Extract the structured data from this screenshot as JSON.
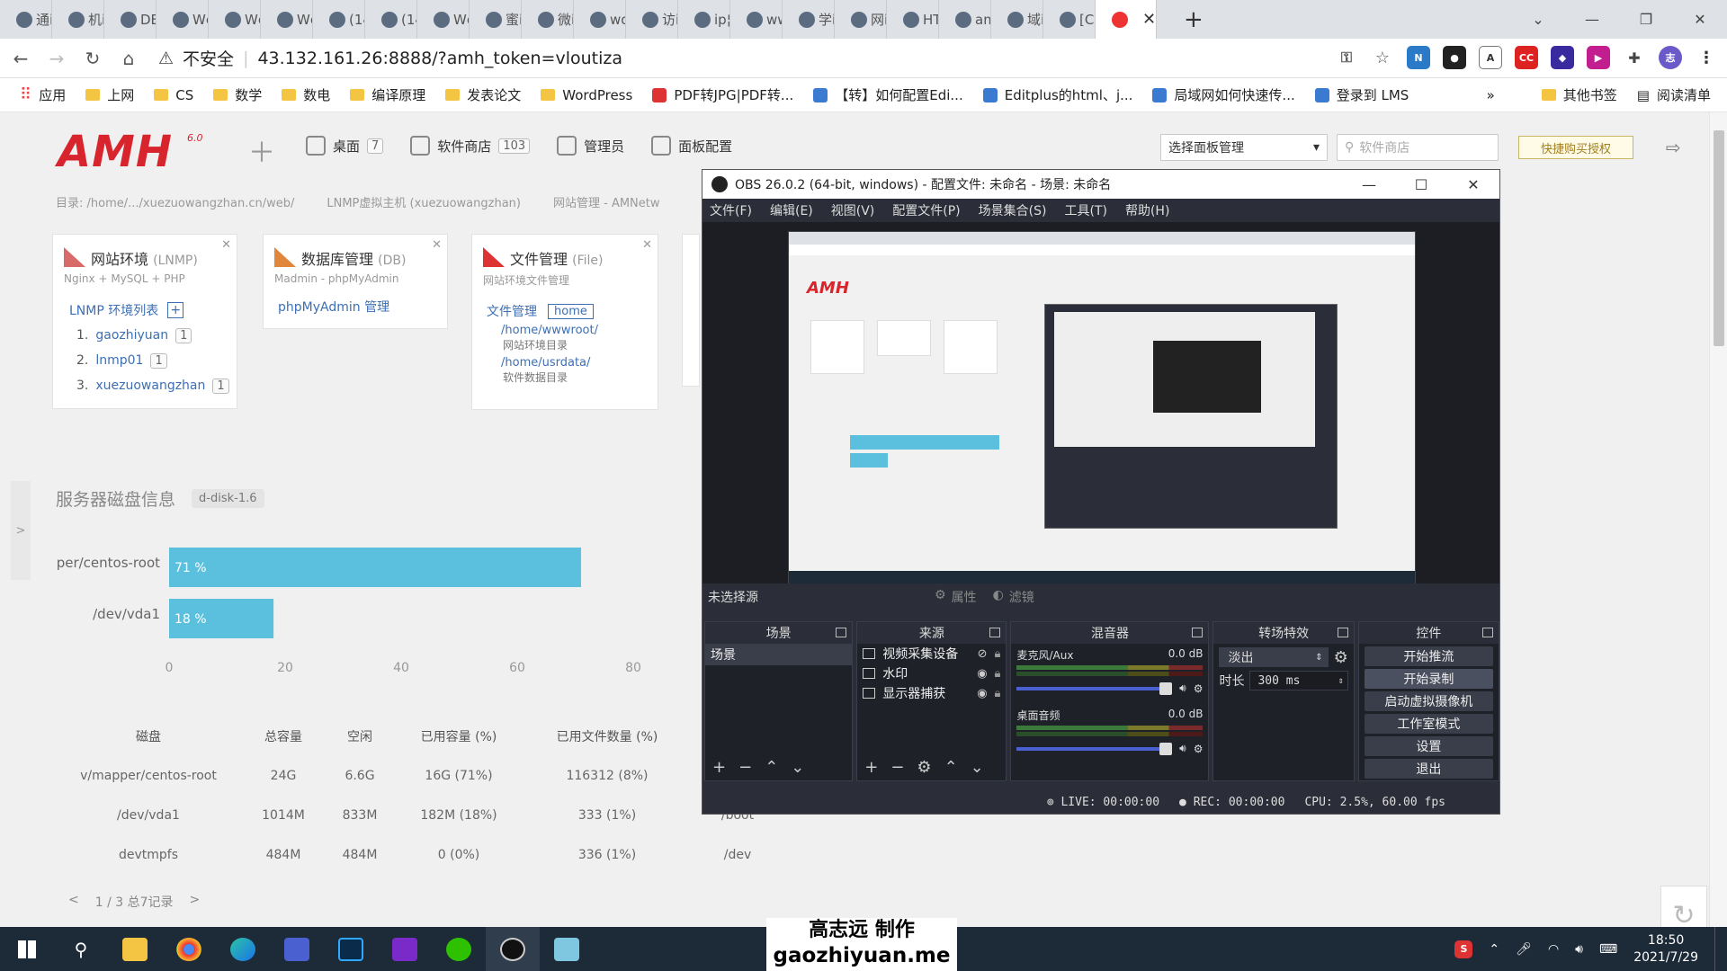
{
  "browser": {
    "tabs": [
      {
        "label": "通i"
      },
      {
        "label": "机i"
      },
      {
        "label": "DE"
      },
      {
        "label": "Wc"
      },
      {
        "label": "Wc"
      },
      {
        "label": "Wc"
      },
      {
        "label": "(14"
      },
      {
        "label": "(14"
      },
      {
        "label": "Wc"
      },
      {
        "label": "蜜i"
      },
      {
        "label": "微i"
      },
      {
        "label": "wo"
      },
      {
        "label": "访i"
      },
      {
        "label": "ip¦"
      },
      {
        "label": "ww"
      },
      {
        "label": "学i"
      },
      {
        "label": "网i"
      },
      {
        "label": "HT"
      },
      {
        "label": "am"
      },
      {
        "label": "域i"
      },
      {
        "label": "[CI"
      },
      {
        "label": ""
      }
    ],
    "insecure_label": "不安全",
    "url": "43.132.161.26:8888/?amh_token=vloutiza",
    "bookmarks": [
      {
        "label": "应用",
        "icon": "apps-icon"
      },
      {
        "label": "上网",
        "icon": "folder-icon"
      },
      {
        "label": "CS",
        "icon": "folder-icon"
      },
      {
        "label": "数学",
        "icon": "folder-icon"
      },
      {
        "label": "数电",
        "icon": "folder-icon"
      },
      {
        "label": "编译原理",
        "icon": "folder-icon"
      },
      {
        "label": "发表论文",
        "icon": "folder-icon"
      },
      {
        "label": "WordPress",
        "icon": "folder-icon"
      },
      {
        "label": "PDF转JPG|PDF转...",
        "icon": "pdf-icon"
      },
      {
        "label": "【转】如何配置Edi...",
        "icon": "link-icon"
      },
      {
        "label": "Editplus的html、j...",
        "icon": "link-icon"
      },
      {
        "label": "局域网如何快速传...",
        "icon": "link-icon"
      },
      {
        "label": "登录到 LMS",
        "icon": "link-icon"
      }
    ],
    "bookmarks_more": "»",
    "other_bookmarks": "其他书签",
    "reading_list": "阅读清单"
  },
  "amh": {
    "logo": "AMH",
    "version": "6.0",
    "nav": [
      {
        "label": "桌面",
        "badge": "7",
        "icon": "home-icon"
      },
      {
        "label": "软件商店",
        "badge": "103",
        "icon": "store-icon"
      },
      {
        "label": "管理员",
        "badge": "",
        "icon": "user-icon"
      },
      {
        "label": "面板配置",
        "badge": "",
        "icon": "gear-icon"
      }
    ],
    "panel_select": "选择面板管理",
    "search_placeholder": "软件商店",
    "buy_button": "快捷购买授权",
    "breadcrumbs": [
      "目录: /home/.../xuezuowangzhan.cn/web/",
      "LNMP虚拟主机 (xuezuowangzhan)",
      "网站管理 - AMNetw"
    ],
    "cards": [
      {
        "title": "网站环境",
        "title_en": "(LNMP)",
        "sub": "Nginx + MySQL + PHP",
        "list_title": "LNMP 环境列表",
        "items": [
          {
            "n": "1.",
            "name": "gaozhiyuan",
            "count": "1"
          },
          {
            "n": "2.",
            "name": "lnmp01",
            "count": "1"
          },
          {
            "n": "3.",
            "name": "xuezuowangzhan",
            "count": "1"
          }
        ]
      },
      {
        "title": "数据库管理",
        "title_en": "(DB)",
        "sub": "Madmin - phpMyAdmin",
        "link": "phpMyAdmin 管理"
      },
      {
        "title": "文件管理",
        "title_en": "(File)",
        "sub": "网站环境文件管理",
        "fm_label": "文件管理",
        "fm_tag": "home",
        "paths": [
          {
            "path": "/home/wwwroot/",
            "desc": "网站环境目录"
          },
          {
            "path": "/home/usrdata/",
            "desc": "软件数据目录"
          }
        ]
      }
    ],
    "disk_title": "服务器磁盘信息",
    "disk_tag": "d-disk-1.6",
    "table": {
      "headers": [
        "磁盘",
        "总容量",
        "空闲",
        "已用容量 (%)",
        "已用文件数量 (%)",
        ""
      ],
      "rows": [
        [
          "v/mapper/centos-root",
          "24G",
          "6.6G",
          "16G (71%)",
          "116312 (8%)",
          ""
        ],
        [
          "/dev/vda1",
          "1014M",
          "833M",
          "182M (18%)",
          "333 (1%)",
          "/boot"
        ],
        [
          "devtmpfs",
          "484M",
          "484M",
          "0 (0%)",
          "336 (1%)",
          "/dev"
        ]
      ]
    },
    "pager": {
      "prev": "<",
      "info": "1 / 3 总7记录",
      "next": ">"
    },
    "side_tab": ">"
  },
  "chart_data": {
    "type": "bar",
    "orientation": "horizontal",
    "categories": [
      "per/centos-root",
      "/dev/vda1"
    ],
    "values": [
      71,
      18
    ],
    "value_labels": [
      "71 %",
      "18 %"
    ],
    "xticks": [
      "0",
      "20",
      "40",
      "60",
      "80"
    ],
    "xlim": [
      0,
      80
    ],
    "bar_color": "#5bc0de",
    "title": "",
    "xlabel": "",
    "ylabel": ""
  },
  "obs": {
    "title": "OBS 26.0.2 (64-bit, windows) - 配置文件: 未命名 - 场景: 未命名",
    "menu": [
      "文件(F)",
      "编辑(E)",
      "视图(V)",
      "配置文件(P)",
      "场景集合(S)",
      "工具(T)",
      "帮助(H)"
    ],
    "no_source": "未选择源",
    "properties": "属性",
    "filters": "滤镜",
    "docks": {
      "scenes": "场景",
      "sources": "来源",
      "mixer": "混音器",
      "transitions": "转场特效",
      "controls": "控件"
    },
    "scene_items": [
      "场景"
    ],
    "sources": [
      "视频采集设备",
      "水印",
      "显示器捕获"
    ],
    "mixer": [
      {
        "name": "麦克风/Aux",
        "db": "0.0 dB"
      },
      {
        "name": "桌面音频",
        "db": "0.0 dB"
      }
    ],
    "transition": "淡出",
    "duration_label": "时长",
    "duration_value": "300 ms",
    "controls": [
      "开始推流",
      "开始录制",
      "启动虚拟摄像机",
      "工作室模式",
      "设置",
      "退出"
    ],
    "status": {
      "live": "LIVE: 00:00:00",
      "rec": "REC: 00:00:00",
      "cpu": "CPU: 2.5%, 60.00 fps"
    }
  },
  "watermark": {
    "line1": "高志远  制作",
    "line2": "gaozhiyuan.me"
  },
  "taskbar": {
    "time": "18:50",
    "date": "2021/7/29"
  }
}
